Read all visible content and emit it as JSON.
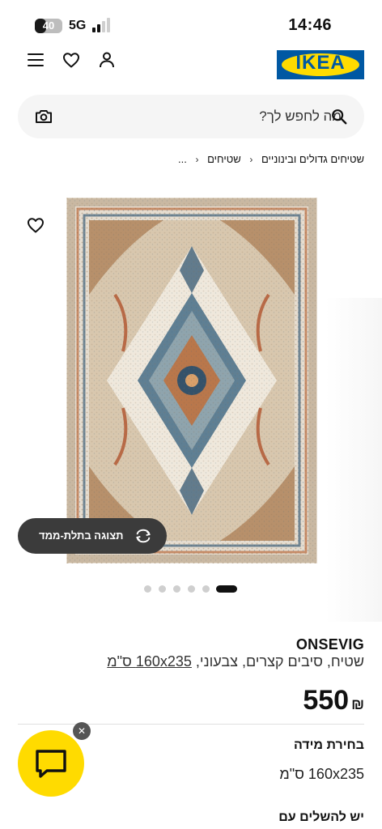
{
  "status_bar": {
    "time": "14:46",
    "battery": "40",
    "battery_level": 0.4,
    "network": "5G"
  },
  "header": {
    "logo_text": "IKEA",
    "icons": [
      "hamburger-menu-icon",
      "heart-icon",
      "person-icon"
    ]
  },
  "search": {
    "placeholder": "מה לחפש לך?"
  },
  "breadcrumb": {
    "items": [
      "...",
      "שטיחים",
      "שטיחים גדולים ובינוניים"
    ]
  },
  "carousel": {
    "view_3d_label": "תצוגה בתלת-ממד",
    "dot_count": 6,
    "active_index": 0
  },
  "product": {
    "name": "ONSEVIG",
    "description_prefix": "שטיח, סיבים קצרים, צבעוני, ",
    "description_size": "160x235 ס\"מ",
    "price": "550",
    "currency": "₪"
  },
  "size_section": {
    "heading": "בחירת מידה",
    "value": "160x235 ס\"מ"
  },
  "complete_section": {
    "heading": "יש להשלים עם"
  },
  "colors": {
    "ikea_blue": "#0058a3",
    "ikea_yellow": "#ffdb00"
  }
}
